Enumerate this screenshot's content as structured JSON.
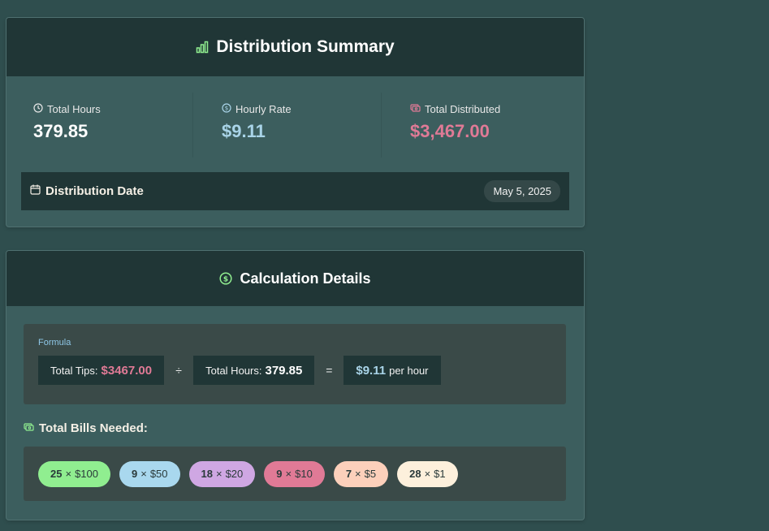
{
  "summary": {
    "title": "Distribution Summary",
    "icon": "bar-chart-icon",
    "stats": {
      "total_hours": {
        "label": "Total Hours",
        "value": "379.85",
        "icon": "clock-icon"
      },
      "hourly_rate": {
        "label": "Hourly Rate",
        "value": "$9.11",
        "icon": "dollar-circle-icon"
      },
      "total_distributed": {
        "label": "Total Distributed",
        "value": "$3,467.00",
        "icon": "banknotes-icon"
      }
    },
    "date": {
      "label": "Distribution Date",
      "value": "May 5, 2025",
      "icon": "calendar-icon"
    }
  },
  "calc": {
    "title": "Calculation Details",
    "icon": "dollar-circle-icon",
    "formula": {
      "title": "Formula",
      "tips_label": "Total Tips:",
      "tips_value": "$3467.00",
      "divide": "÷",
      "hours_label": "Total Hours:",
      "hours_value": "379.85",
      "equals": "=",
      "rate_value": "$9.11",
      "rate_unit": "per hour"
    },
    "bills_title": "Total Bills Needed:",
    "bills": [
      {
        "count": "25",
        "sep": "×",
        "denom": "$100",
        "color": "#90ee90"
      },
      {
        "count": "9",
        "sep": "×",
        "denom": "$50",
        "color": "#a9d8ee"
      },
      {
        "count": "18",
        "sep": "×",
        "denom": "$20",
        "color": "#cfa7e3"
      },
      {
        "count": "9",
        "sep": "×",
        "denom": "$10",
        "color": "#e07a96"
      },
      {
        "count": "7",
        "sep": "×",
        "denom": "$5",
        "color": "#fcd0bb"
      },
      {
        "count": "28",
        "sep": "×",
        "denom": "$1",
        "color": "#fdf0dc"
      }
    ]
  },
  "colors": {
    "background": "#2f4e4e",
    "card": "#3c5e5e",
    "header": "#203636",
    "accent_green": "#90ee90",
    "accent_pink": "#e07a96",
    "accent_blue": "#a9d4e8"
  }
}
